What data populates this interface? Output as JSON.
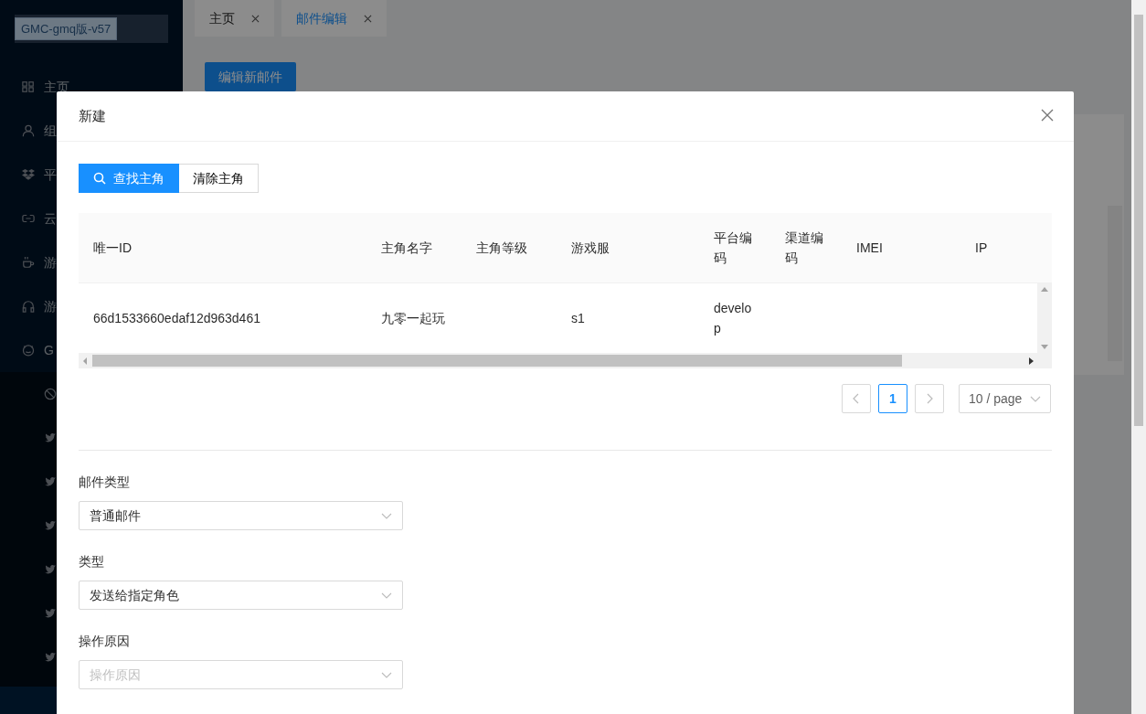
{
  "sidebar": {
    "logo": "GMC-gmq版-v57",
    "items": [
      {
        "label": "主页"
      },
      {
        "label": "组"
      },
      {
        "label": "平"
      },
      {
        "label": "云"
      },
      {
        "label": "游"
      },
      {
        "label": "游"
      },
      {
        "label": "G"
      }
    ]
  },
  "tabs": [
    {
      "label": "主页",
      "selected": false
    },
    {
      "label": "邮件编辑",
      "selected": true
    }
  ],
  "page_button": "编辑新邮件",
  "modal": {
    "title": "新建",
    "buttons": [
      {
        "label": "查找主角",
        "kind": "primary"
      },
      {
        "label": "清除主角",
        "kind": "default"
      }
    ],
    "table": {
      "columns": [
        "唯一ID",
        "主角名字",
        "主角等级",
        "游戏服",
        "平台编码",
        "渠道编码",
        "IMEI",
        "IP"
      ],
      "rows": [
        [
          "66d1533660edaf12d963d461",
          "九零一起玩",
          "",
          "s1",
          "develop",
          "",
          "",
          ""
        ]
      ]
    },
    "pagination": {
      "pages": [
        {
          "label": "1",
          "selected": true
        }
      ],
      "page_size": "10 / page"
    },
    "fields": [
      {
        "label": "邮件类型",
        "value": "普通邮件"
      },
      {
        "label": "类型",
        "value": "发送给指定角色"
      },
      {
        "label": "操作原因",
        "placeholder": "操作原因"
      }
    ]
  }
}
